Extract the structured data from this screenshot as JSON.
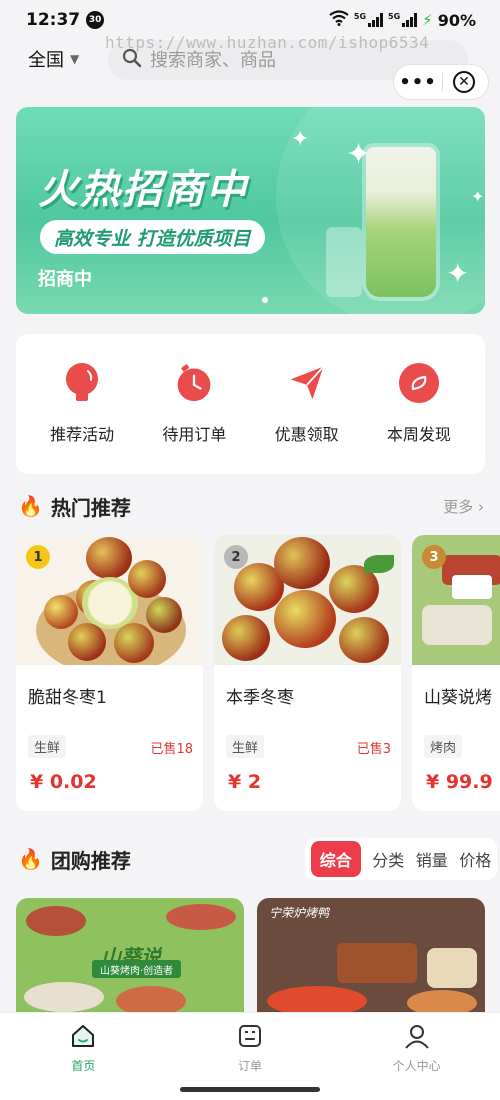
{
  "status_bar": {
    "time": "12:37",
    "badge": "30",
    "network": "5G",
    "battery": "90%"
  },
  "watermark": "https://www.huzhan.com/ishop6534",
  "header": {
    "region": "全国",
    "search_placeholder": "搜索商家、商品",
    "capsule_more": "•••"
  },
  "banner": {
    "title": "火热招商中",
    "subtitle": "高效专业 打造优质项目",
    "tag": "招商中"
  },
  "quick_nav": [
    {
      "label": "推荐活动",
      "icon": "bulb-icon"
    },
    {
      "label": "待用订单",
      "icon": "clock-icon"
    },
    {
      "label": "优惠领取",
      "icon": "send-icon"
    },
    {
      "label": "本周发现",
      "icon": "compass-icon"
    }
  ],
  "hot": {
    "title": "热门推荐",
    "more": "更多 ›",
    "products": [
      {
        "rank": "1",
        "name": "脆甜冬枣1",
        "category": "生鲜",
        "sold": "已售18",
        "price": "¥ 0.02"
      },
      {
        "rank": "2",
        "name": "本季冬枣",
        "category": "生鲜",
        "sold": "已售3",
        "price": "¥ 2"
      },
      {
        "rank": "3",
        "name": "山葵说烤",
        "category": "烤肉",
        "sold": "",
        "price": "¥ 99.9"
      }
    ]
  },
  "group": {
    "title": "团购推荐",
    "tabs": [
      "综合",
      "分类",
      "销量",
      "价格"
    ],
    "cards": [
      {
        "brand": "山葵说",
        "tagline": "山葵烤肉·创造者"
      },
      {
        "brand": "宁荣炉烤鸭"
      }
    ]
  },
  "tab_bar": [
    {
      "label": "首页"
    },
    {
      "label": "订单"
    },
    {
      "label": "个人中心"
    }
  ],
  "colors": {
    "accent": "#ee3d4a",
    "active_tab": "#2aa36b",
    "price": "#e5332f",
    "banner": "#4fc79f"
  }
}
